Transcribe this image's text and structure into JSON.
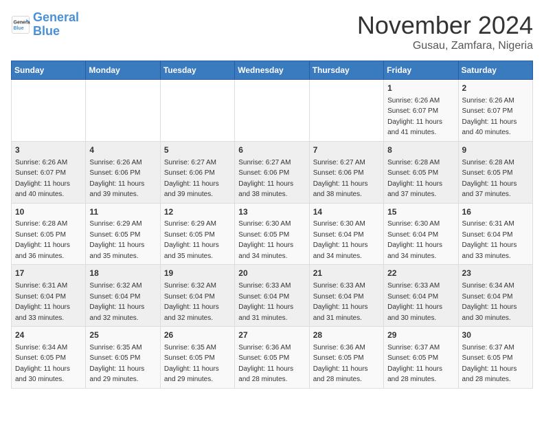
{
  "logo": {
    "line1": "General",
    "line2": "Blue"
  },
  "title": "November 2024",
  "location": "Gusau, Zamfara, Nigeria",
  "days_of_week": [
    "Sunday",
    "Monday",
    "Tuesday",
    "Wednesday",
    "Thursday",
    "Friday",
    "Saturday"
  ],
  "weeks": [
    [
      {
        "day": "",
        "info": ""
      },
      {
        "day": "",
        "info": ""
      },
      {
        "day": "",
        "info": ""
      },
      {
        "day": "",
        "info": ""
      },
      {
        "day": "",
        "info": ""
      },
      {
        "day": "1",
        "info": "Sunrise: 6:26 AM\nSunset: 6:07 PM\nDaylight: 11 hours and 41 minutes."
      },
      {
        "day": "2",
        "info": "Sunrise: 6:26 AM\nSunset: 6:07 PM\nDaylight: 11 hours and 40 minutes."
      }
    ],
    [
      {
        "day": "3",
        "info": "Sunrise: 6:26 AM\nSunset: 6:07 PM\nDaylight: 11 hours and 40 minutes."
      },
      {
        "day": "4",
        "info": "Sunrise: 6:26 AM\nSunset: 6:06 PM\nDaylight: 11 hours and 39 minutes."
      },
      {
        "day": "5",
        "info": "Sunrise: 6:27 AM\nSunset: 6:06 PM\nDaylight: 11 hours and 39 minutes."
      },
      {
        "day": "6",
        "info": "Sunrise: 6:27 AM\nSunset: 6:06 PM\nDaylight: 11 hours and 38 minutes."
      },
      {
        "day": "7",
        "info": "Sunrise: 6:27 AM\nSunset: 6:06 PM\nDaylight: 11 hours and 38 minutes."
      },
      {
        "day": "8",
        "info": "Sunrise: 6:28 AM\nSunset: 6:05 PM\nDaylight: 11 hours and 37 minutes."
      },
      {
        "day": "9",
        "info": "Sunrise: 6:28 AM\nSunset: 6:05 PM\nDaylight: 11 hours and 37 minutes."
      }
    ],
    [
      {
        "day": "10",
        "info": "Sunrise: 6:28 AM\nSunset: 6:05 PM\nDaylight: 11 hours and 36 minutes."
      },
      {
        "day": "11",
        "info": "Sunrise: 6:29 AM\nSunset: 6:05 PM\nDaylight: 11 hours and 35 minutes."
      },
      {
        "day": "12",
        "info": "Sunrise: 6:29 AM\nSunset: 6:05 PM\nDaylight: 11 hours and 35 minutes."
      },
      {
        "day": "13",
        "info": "Sunrise: 6:30 AM\nSunset: 6:05 PM\nDaylight: 11 hours and 34 minutes."
      },
      {
        "day": "14",
        "info": "Sunrise: 6:30 AM\nSunset: 6:04 PM\nDaylight: 11 hours and 34 minutes."
      },
      {
        "day": "15",
        "info": "Sunrise: 6:30 AM\nSunset: 6:04 PM\nDaylight: 11 hours and 34 minutes."
      },
      {
        "day": "16",
        "info": "Sunrise: 6:31 AM\nSunset: 6:04 PM\nDaylight: 11 hours and 33 minutes."
      }
    ],
    [
      {
        "day": "17",
        "info": "Sunrise: 6:31 AM\nSunset: 6:04 PM\nDaylight: 11 hours and 33 minutes."
      },
      {
        "day": "18",
        "info": "Sunrise: 6:32 AM\nSunset: 6:04 PM\nDaylight: 11 hours and 32 minutes."
      },
      {
        "day": "19",
        "info": "Sunrise: 6:32 AM\nSunset: 6:04 PM\nDaylight: 11 hours and 32 minutes."
      },
      {
        "day": "20",
        "info": "Sunrise: 6:33 AM\nSunset: 6:04 PM\nDaylight: 11 hours and 31 minutes."
      },
      {
        "day": "21",
        "info": "Sunrise: 6:33 AM\nSunset: 6:04 PM\nDaylight: 11 hours and 31 minutes."
      },
      {
        "day": "22",
        "info": "Sunrise: 6:33 AM\nSunset: 6:04 PM\nDaylight: 11 hours and 30 minutes."
      },
      {
        "day": "23",
        "info": "Sunrise: 6:34 AM\nSunset: 6:04 PM\nDaylight: 11 hours and 30 minutes."
      }
    ],
    [
      {
        "day": "24",
        "info": "Sunrise: 6:34 AM\nSunset: 6:05 PM\nDaylight: 11 hours and 30 minutes."
      },
      {
        "day": "25",
        "info": "Sunrise: 6:35 AM\nSunset: 6:05 PM\nDaylight: 11 hours and 29 minutes."
      },
      {
        "day": "26",
        "info": "Sunrise: 6:35 AM\nSunset: 6:05 PM\nDaylight: 11 hours and 29 minutes."
      },
      {
        "day": "27",
        "info": "Sunrise: 6:36 AM\nSunset: 6:05 PM\nDaylight: 11 hours and 28 minutes."
      },
      {
        "day": "28",
        "info": "Sunrise: 6:36 AM\nSunset: 6:05 PM\nDaylight: 11 hours and 28 minutes."
      },
      {
        "day": "29",
        "info": "Sunrise: 6:37 AM\nSunset: 6:05 PM\nDaylight: 11 hours and 28 minutes."
      },
      {
        "day": "30",
        "info": "Sunrise: 6:37 AM\nSunset: 6:05 PM\nDaylight: 11 hours and 28 minutes."
      }
    ]
  ]
}
